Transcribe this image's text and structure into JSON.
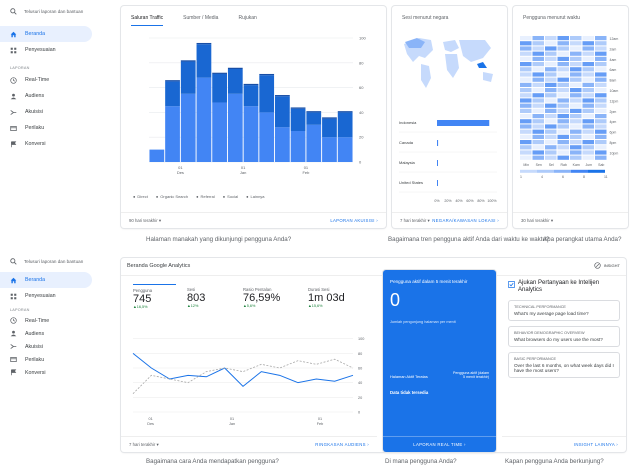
{
  "sidebar_top": {
    "search": "Telusuri laporan dan bantuan",
    "items": [
      {
        "label": "Beranda",
        "icon": "home-icon",
        "active": true
      },
      {
        "label": "Penyesuaian",
        "icon": "grid-icon",
        "active": false
      }
    ],
    "section": "LAPORAN",
    "reports": [
      {
        "label": "Real-Time",
        "icon": "clock-icon"
      },
      {
        "label": "Audiens",
        "icon": "person-icon"
      },
      {
        "label": "Akuisisi",
        "icon": "acquisition-icon"
      },
      {
        "label": "Perilaku",
        "icon": "behavior-icon"
      },
      {
        "label": "Konversi",
        "icon": "flag-icon"
      }
    ]
  },
  "traffic_card": {
    "tabs": [
      "Saluran Traffic",
      "Sumber / Media",
      "Rujukan"
    ],
    "legend": [
      "Direct",
      "Organic Search",
      "Referral",
      "Social",
      "Lainnya"
    ],
    "footer_left": "90 hari terakhir ▾",
    "footer_link": "LAPORAN AKUISISI ›"
  },
  "country_card": {
    "title": "Sesi menurut negara",
    "footer_left": "7 hari terakhir ▾",
    "footer_link": "NEGARA/KAWASAN LOKASI ›"
  },
  "time_card": {
    "title": "Pengguna menurut waktu",
    "footer_left": "30 hari terakhir ▾"
  },
  "questions_top": [
    "Halaman manakah yang dikunjungi pengguna Anda?",
    "Bagaimana tren pengguna aktif Anda dari waktu ke waktu?",
    "Apa perangkat utama Anda?"
  ],
  "sidebar_bottom": {
    "search": "Telusuri laporan dan bantuan",
    "items": [
      {
        "label": "Beranda",
        "icon": "home-icon",
        "active": true
      },
      {
        "label": "Penyesuaian",
        "icon": "grid-icon",
        "active": false
      }
    ],
    "section": "LAPORAN",
    "reports": [
      {
        "label": "Real-Time",
        "icon": "clock-icon"
      },
      {
        "label": "Audiens",
        "icon": "person-icon"
      },
      {
        "label": "Akuisisi",
        "icon": "acquisition-icon"
      },
      {
        "label": "Perilaku",
        "icon": "behavior-icon"
      },
      {
        "label": "Konversi",
        "icon": "flag-icon"
      }
    ]
  },
  "home_card": {
    "title": "Beranda Google Analytics",
    "insights_btn": "INSIGHT",
    "metrics": [
      {
        "label": "Pengguna",
        "value": "745",
        "change": "▲16,5%"
      },
      {
        "label": "Sesi",
        "value": "803",
        "change": "▲12%"
      },
      {
        "label": "Rasio Pentalan",
        "value": "76,59%",
        "change": "▲5,6%"
      },
      {
        "label": "Durasi Sesi",
        "value": "1m 03d",
        "change": "▲15,6%"
      }
    ],
    "footer_left": "7 hari terakhir ▾",
    "footer_link": "RINGKASAN AUDIENS ›"
  },
  "realtime_card": {
    "title": "Pengguna aktif dalam 5 menit terakhir",
    "value": "0",
    "sub": "Jumlah pengunjung halaman per menit",
    "table_left": "Halaman Aktif Teratas",
    "table_right": "Pengguna aktif (dalam 5 menit terakhir)",
    "empty": "Data tidak tersedia",
    "footer_link": "LAPORAN REAL TIME ›"
  },
  "insights_card": {
    "title": "Ajukan Pertanyaan ke Intelijen Analytics",
    "items": [
      {
        "category": "TECHNICAL PERFORMANCE",
        "text": "What's my average page load time?"
      },
      {
        "category": "BEHAVIOR DEMOGRAPHIC OVERVIEW",
        "text": "What browsers do my users use the most?"
      },
      {
        "category": "BASIC PERFORMANCE",
        "text": "Over the last 6 months, on what week days did I have the most users?"
      }
    ],
    "footer_link": "INSIGHT LAINNYA ›"
  },
  "questions_bottom": [
    "Bagaimana cara Anda mendapatkan pengguna?",
    "Di mana pengguna Anda?",
    "Kapan pengguna Anda berkunjung?"
  ],
  "chart_data": [
    {
      "type": "bar",
      "stacked": true,
      "categories": [
        "1",
        "2",
        "3",
        "4",
        "5",
        "6",
        "7",
        "8",
        "9",
        "10",
        "11",
        "12",
        "13"
      ],
      "x_tick_labels": [
        "01 Des",
        "01 Jan",
        "01 Feb"
      ],
      "ylim": [
        0,
        100
      ],
      "y_ticks": [
        0,
        20,
        40,
        60,
        80,
        100
      ],
      "series": [
        {
          "name": "Direct",
          "values": [
            10,
            45,
            55,
            68,
            48,
            55,
            45,
            40,
            28,
            25,
            30,
            20,
            20
          ]
        },
        {
          "name": "Organic Search",
          "values": [
            0,
            20,
            26,
            27,
            23,
            20,
            17,
            30,
            25,
            18,
            10,
            15,
            20
          ]
        },
        {
          "name": "Referral",
          "values": [
            0,
            1,
            1,
            1,
            1,
            1,
            1,
            1,
            1,
            1,
            1,
            1,
            1
          ]
        },
        {
          "name": "Social",
          "values": [
            0,
            0,
            0,
            0,
            0,
            0,
            0,
            0,
            0,
            0,
            0,
            0,
            0
          ]
        },
        {
          "name": "Lainnya",
          "values": [
            0,
            0,
            0,
            0,
            0,
            0,
            0,
            0,
            0,
            0,
            0,
            0,
            0
          ]
        }
      ],
      "colors": [
        "#4285f4",
        "#1967d2",
        "#174ea6",
        "#8ab4f8",
        "#c6dafc"
      ]
    },
    {
      "type": "bar",
      "orientation": "horizontal",
      "categories": [
        "Indonesia",
        "Canada",
        "Malaysia",
        "United States"
      ],
      "values": [
        95,
        2,
        1,
        1
      ],
      "x_tick_labels": [
        "0%",
        "20%",
        "40%",
        "60%",
        "80%",
        "100%"
      ],
      "xlim": [
        0,
        100
      ]
    },
    {
      "type": "heatmap",
      "x_tick_labels": [
        "Min",
        "Sen",
        "Sel",
        "Rab",
        "Kam",
        "Jum",
        "Sab"
      ],
      "y_tick_labels": [
        "12am",
        "2am",
        "4am",
        "6am",
        "8am",
        "10am",
        "12pm",
        "2pm",
        "4pm",
        "6pm",
        "8pm",
        "10pm"
      ],
      "scale_labels": [
        "1",
        "4",
        "6",
        "8",
        "11"
      ]
    },
    {
      "type": "line",
      "x_tick_labels": [
        "01 Des",
        "01 Jan",
        "01 Feb"
      ],
      "ylim": [
        0,
        120
      ],
      "y_ticks": [
        0,
        20,
        40,
        60,
        80,
        100
      ],
      "series": [
        {
          "name": "",
          "values": [
            80,
            60,
            45,
            50,
            48,
            60,
            35,
            55,
            50,
            40,
            45,
            42,
            50
          ]
        },
        {
          "name": "",
          "values": [
            25,
            50,
            45,
            40,
            55,
            60,
            55,
            65,
            60,
            70,
            65,
            72,
            60
          ]
        }
      ]
    }
  ]
}
